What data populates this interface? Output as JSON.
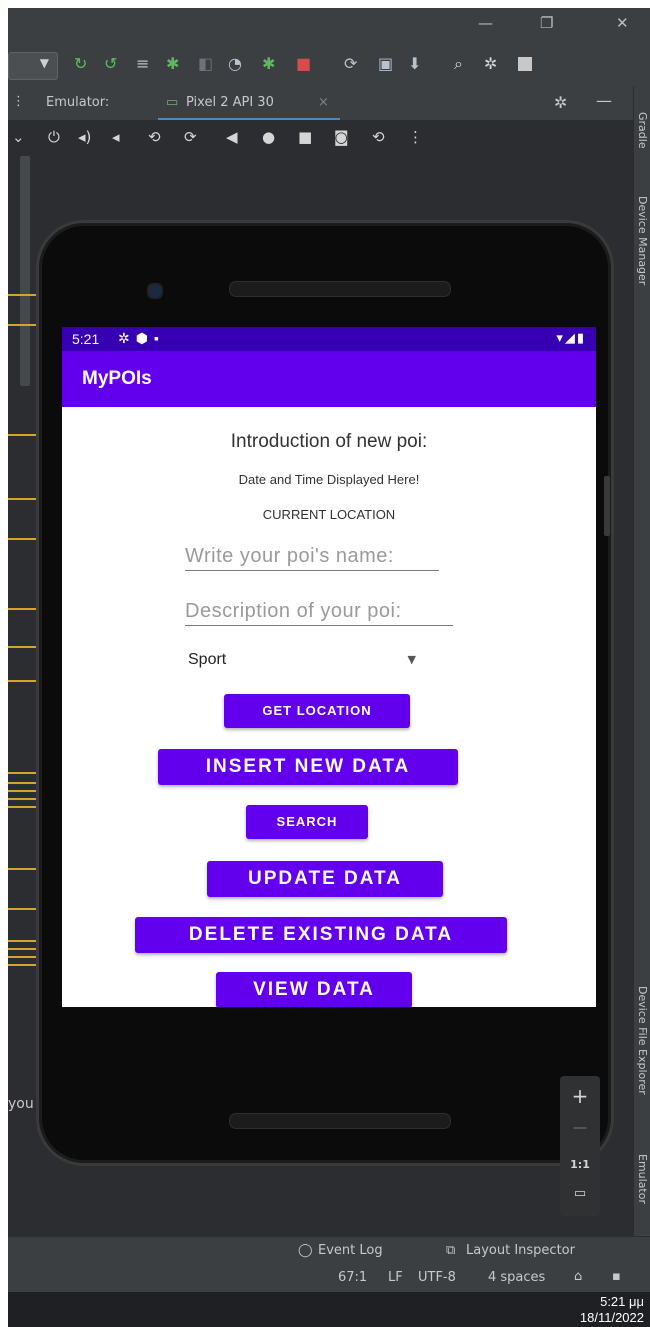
{
  "ide": {
    "window_controls": {
      "minimize": "—",
      "maximize": "❐",
      "close": "✕"
    },
    "tab_bar": {
      "emulator_label": "Emulator:",
      "device_tab": "Pixel 2 API 30",
      "device_tab_close": "×"
    },
    "right_panels": [
      "Gradle",
      "Device Manager",
      "Device File Explorer",
      "Emulator"
    ],
    "left_fragment": "you",
    "status_bar": {
      "event_log": "Event Log",
      "layout_inspector": "Layout Inspector",
      "position": "67:1",
      "line_sep": "LF",
      "encoding": "UTF-8",
      "indent": "4 spaces"
    },
    "zoom": {
      "plus": "+",
      "minus": "—",
      "ratio": "1:1"
    },
    "taskbar": {
      "time": "5:21 μμ",
      "date": "18/11/2022"
    }
  },
  "phone": {
    "status_time": "5:21",
    "app_title": "MyPOIs",
    "heading": "Introduction of new poi:",
    "datetime_placeholder": "Date and Time Displayed Here!",
    "location_label": "CURRENT LOCATION",
    "name_hint": "Write your poi's name:",
    "description_hint": "Description of your poi:",
    "category_value": "Sport",
    "buttons": {
      "get_location": "GET LOCATION",
      "insert": "INSERT NEW DATA",
      "search": "SEARCH",
      "update": "UPDATE DATA",
      "delete": "DELETE EXISTING DATA",
      "view": "VIEW DATA"
    }
  },
  "colors": {
    "primary": "#6200ee",
    "primary_dark": "#3700b3",
    "ide_bg": "#2b2d30",
    "ruler_accent": "#d8a32a"
  }
}
